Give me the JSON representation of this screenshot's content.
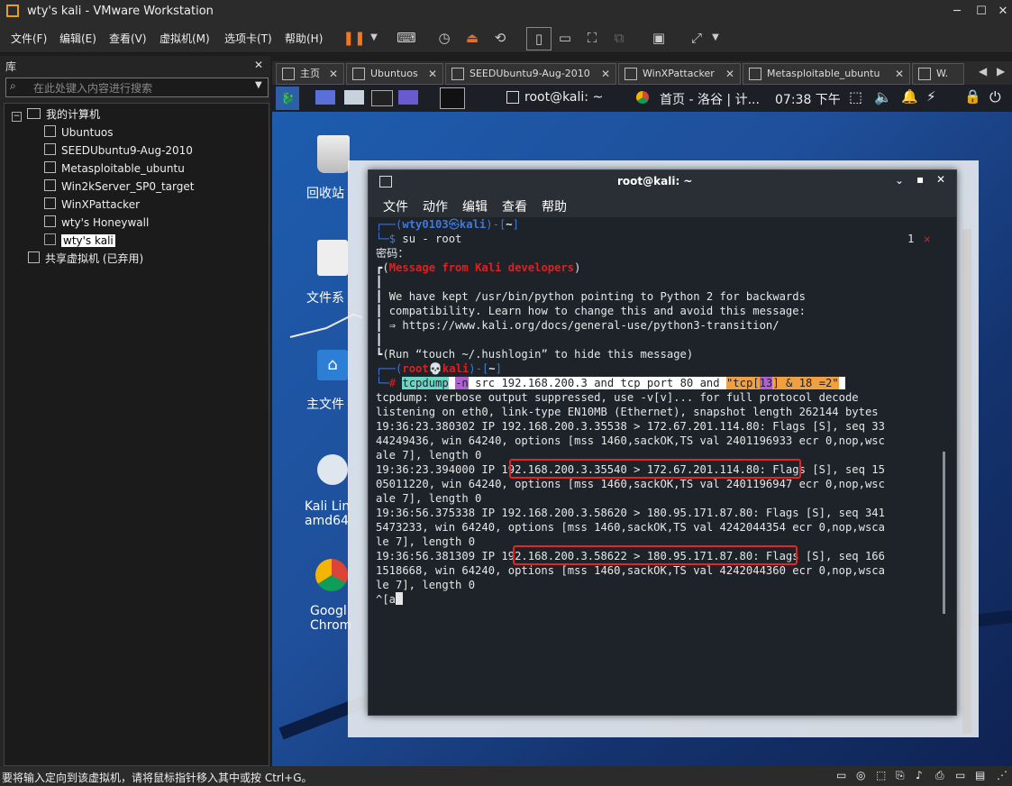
{
  "window": {
    "title": "wty's kali - VMware Workstation"
  },
  "menubar": {
    "items": [
      "文件(F)",
      "编辑(E)",
      "查看(V)",
      "虚拟机(M)",
      "选项卡(T)",
      "帮助(H)"
    ]
  },
  "library": {
    "title": "库",
    "search_placeholder": "在此处键入内容进行搜索",
    "root": "我的计算机",
    "vms": [
      "Ubuntuos",
      "SEEDUbuntu9-Aug-2010",
      "Metasploitable_ubuntu",
      "Win2kServer_SP0_target",
      "WinXPattacker",
      "wty's Honeywall",
      "wty's kali"
    ],
    "shared": "共享虚拟机 (已弃用)"
  },
  "tabs": [
    "主页",
    "Ubuntuos",
    "SEEDUbuntu9-Aug-2010",
    "WinXPattacker",
    "Metasploitable_ubuntu",
    "W."
  ],
  "kali_panel": {
    "terminal_task": "root@kali: ~",
    "browser_task": "首页 - 洛谷 | 计...",
    "clock": "07:38 下午"
  },
  "desktop": {
    "icons": [
      "回收站",
      "文件系",
      "主文件",
      "Kali Lin\namd64",
      "Googl\nChrom"
    ]
  },
  "terminal": {
    "title": "root@kali: ~",
    "menu": [
      "文件",
      "动作",
      "编辑",
      "查看",
      "帮助"
    ],
    "prompt_user": "wty0103",
    "prompt_host": "kali",
    "prompt_dir": "~",
    "cmd_su": "su - root",
    "exit_badge": "1",
    "password_line": "密码：",
    "msg_title": "Message from Kali developers",
    "msg_lines": [
      "We have kept /usr/bin/python pointing to Python 2 for backwards",
      "compatibility. Learn how to change this and avoid this message:",
      "⇒ https://www.kali.org/docs/general-use/python3-transition/"
    ],
    "msg_run": "(Run “touch ~/.hushlogin” to hide this message)",
    "root_user": "root",
    "root_host": "kali",
    "cmd_tcpdump": "tcpdump",
    "cmd_opt": "-n",
    "cmd_mid": " src 192.168.200.3 and tcp port 80 and ",
    "cmd_str_a": "\"tcp[",
    "cmd_num_a": "13",
    "cmd_str_b": "] & 18 =2\"",
    "output": [
      "tcpdump: verbose output suppressed, use -v[v]... for full protocol decode",
      "listening on eth0, link-type EN10MB (Ethernet), snapshot length 262144 bytes",
      "19:36:23.380302 IP 192.168.200.3.35538 > 172.67.201.114.80: Flags [S], seq 33",
      "44249436, win 64240, options [mss 1460,sackOK,TS val 2401196933 ecr 0,nop,wsc",
      "ale 7], length 0",
      "19:36:23.394000 IP 192.168.200.3.35540 > 172.67.201.114.80: Flags [S], seq 15",
      "05011220, win 64240, options [mss 1460,sackOK,TS val 2401196947 ecr 0,nop,wsc",
      "ale 7], length 0",
      "19:36:56.375338 IP 192.168.200.3.58620 > 180.95.171.87.80: Flags [S], seq 341",
      "5473233, win 64240, options [mss 1460,sackOK,TS val 4242044354 ecr 0,nop,wsca",
      "le 7], length 0",
      "19:36:56.381309 IP 192.168.200.3.58622 > 180.95.171.87.80: Flags [S], seq 166",
      "1518668, win 64240, options [mss 1460,sackOK,TS val 4242044360 ecr 0,nop,wsca",
      "le 7], length 0",
      "^[a"
    ]
  },
  "status": {
    "text": "要将输入定向到该虚拟机，请将鼠标指针移入其中或按 Ctrl+G。"
  },
  "colors": {
    "highlight_box": "#e52525",
    "prompt_blue": "#3f7ad8",
    "root_red": "#e02020"
  }
}
